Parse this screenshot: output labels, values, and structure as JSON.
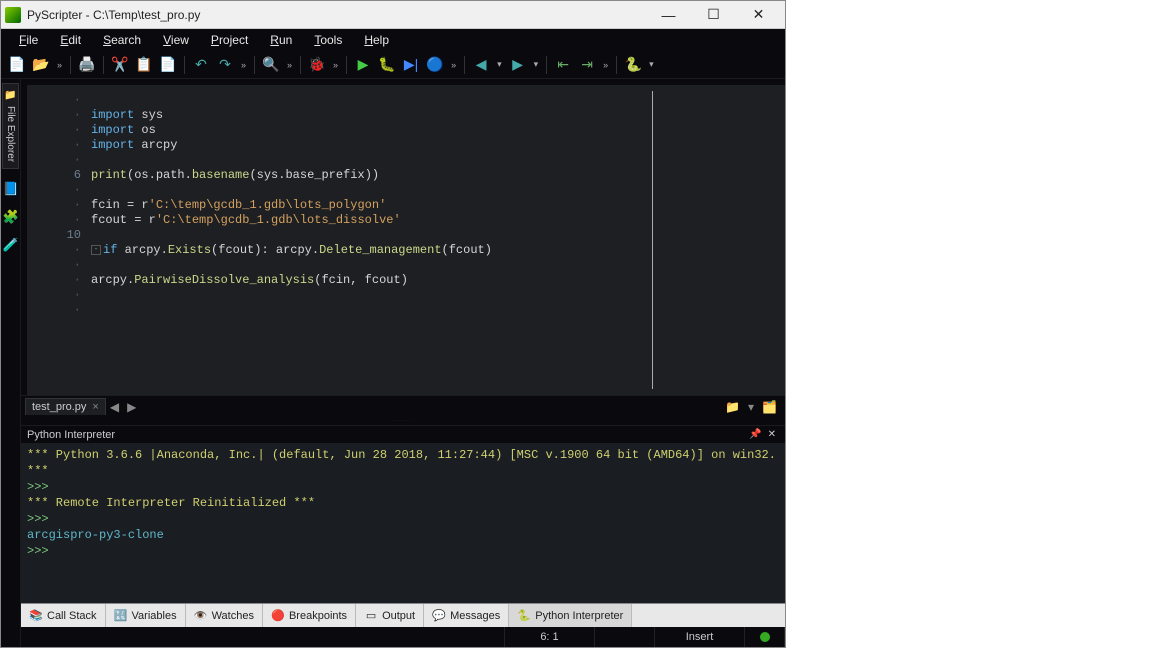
{
  "window": {
    "title": "PyScripter - C:\\Temp\\test_pro.py"
  },
  "menu": {
    "file": "File",
    "edit": "Edit",
    "search": "Search",
    "view": "View",
    "project": "Project",
    "run": "Run",
    "tools": "Tools",
    "help": "Help"
  },
  "side": {
    "file_explorer": "File Explorer"
  },
  "editor": {
    "lines": [
      {
        "n": "·",
        "tokens": []
      },
      {
        "n": "·",
        "tokens": [
          [
            "kw",
            "import "
          ],
          [
            "id",
            "sys"
          ]
        ]
      },
      {
        "n": "·",
        "tokens": [
          [
            "kw",
            "import "
          ],
          [
            "id",
            "os"
          ]
        ]
      },
      {
        "n": "·",
        "tokens": [
          [
            "kw",
            "import "
          ],
          [
            "id",
            "arcpy"
          ]
        ]
      },
      {
        "n": "·",
        "tokens": []
      },
      {
        "n": "6",
        "tokens": [
          [
            "fn",
            "print"
          ],
          [
            "par",
            "("
          ],
          [
            "id",
            "os"
          ],
          [
            "op",
            "."
          ],
          [
            "id",
            "path"
          ],
          [
            "op",
            "."
          ],
          [
            "fn",
            "basename"
          ],
          [
            "par",
            "("
          ],
          [
            "id",
            "sys"
          ],
          [
            "op",
            "."
          ],
          [
            "id",
            "base_prefix"
          ],
          [
            "par",
            "))"
          ]
        ]
      },
      {
        "n": "·",
        "tokens": []
      },
      {
        "n": "·",
        "tokens": [
          [
            "id",
            "fcin "
          ],
          [
            "op",
            "= "
          ],
          [
            "id",
            "r"
          ],
          [
            "str",
            "'C:\\temp\\gcdb_1.gdb\\lots_polygon'"
          ]
        ]
      },
      {
        "n": "·",
        "tokens": [
          [
            "id",
            "fcout "
          ],
          [
            "op",
            "= "
          ],
          [
            "id",
            "r"
          ],
          [
            "str",
            "'C:\\temp\\gcdb_1.gdb\\lots_dissolve'"
          ]
        ]
      },
      {
        "n": "10",
        "tokens": []
      },
      {
        "n": "·",
        "fold": true,
        "tokens": [
          [
            "kw",
            "if "
          ],
          [
            "id",
            "arcpy"
          ],
          [
            "op",
            "."
          ],
          [
            "fn",
            "Exists"
          ],
          [
            "par",
            "("
          ],
          [
            "id",
            "fcout"
          ],
          [
            "par",
            "): "
          ],
          [
            "id",
            "arcpy"
          ],
          [
            "op",
            "."
          ],
          [
            "fn",
            "Delete_management"
          ],
          [
            "par",
            "("
          ],
          [
            "id",
            "fcout"
          ],
          [
            "par",
            ")"
          ]
        ]
      },
      {
        "n": "·",
        "tokens": []
      },
      {
        "n": "·",
        "tokens": [
          [
            "id",
            "arcpy"
          ],
          [
            "op",
            "."
          ],
          [
            "fn",
            "PairwiseDissolve_analysis"
          ],
          [
            "par",
            "("
          ],
          [
            "id",
            "fcin"
          ],
          [
            "op",
            ", "
          ],
          [
            "id",
            "fcout"
          ],
          [
            "par",
            ")"
          ]
        ]
      },
      {
        "n": "·",
        "tokens": []
      },
      {
        "n": "·",
        "tokens": []
      }
    ]
  },
  "file_tab": {
    "name": "test_pro.py"
  },
  "panel": {
    "title": "Python Interpreter"
  },
  "console": {
    "lines": [
      {
        "cls": "c-yellow",
        "text": "*** Python 3.6.6 |Anaconda, Inc.| (default, Jun 28 2018, 11:27:44) [MSC v.1900 64 bit (AMD64)] on win32. ***"
      },
      {
        "cls": "c-green",
        "text": ">>> "
      },
      {
        "cls": "c-yellow",
        "text": "*** Remote Interpreter Reinitialized  ***"
      },
      {
        "cls": "c-green",
        "text": ">>> "
      },
      {
        "cls": "c-cyan",
        "text": "arcgispro-py3-clone"
      },
      {
        "cls": "c-green",
        "text": ">>> "
      }
    ]
  },
  "bottom_tabs": {
    "call_stack": "Call Stack",
    "variables": "Variables",
    "watches": "Watches",
    "breakpoints": "Breakpoints",
    "output": "Output",
    "messages": "Messages",
    "python_interpreter": "Python Interpreter"
  },
  "status": {
    "cursor": "6: 1",
    "mode": "Insert"
  }
}
